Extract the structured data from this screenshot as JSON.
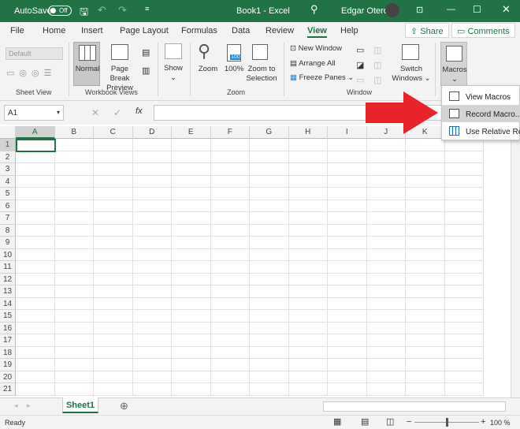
{
  "title_bar": {
    "autosave": "AutoSave",
    "autosave_state": "Off",
    "title": "Book1 - Excel",
    "user": "Edgar Otero",
    "accent": "#217346"
  },
  "tabs": [
    "File",
    "Home",
    "Insert",
    "Page Layout",
    "Formulas",
    "Data",
    "Review",
    "View",
    "Help"
  ],
  "active_tab": "View",
  "share": "Share",
  "comments": "Comments",
  "ribbon": {
    "sheet_view": {
      "dropdown": "Default",
      "label": "Sheet View"
    },
    "workbook_views": {
      "normal": "Normal",
      "page_break_1": "Page Break",
      "page_break_2": "Preview",
      "label": "Workbook Views"
    },
    "show": {
      "label": "Show"
    },
    "zoom": {
      "zoom": "Zoom",
      "hundred": "100%",
      "icon_text": "100",
      "zoom_sel_1": "Zoom to",
      "zoom_sel_2": "Selection",
      "label": "Zoom"
    },
    "window": {
      "new_window": "New Window",
      "arrange_all": "Arrange All",
      "freeze_panes": "Freeze Panes",
      "switch_1": "Switch",
      "switch_2": "Windows",
      "label": "Window"
    },
    "macros": {
      "label": "Macros"
    }
  },
  "macros_menu": [
    "View Macros",
    "Record Macro...",
    "Use Relative References"
  ],
  "name_box": "A1",
  "columns": [
    "A",
    "B",
    "C",
    "D",
    "E",
    "F",
    "G",
    "H",
    "I",
    "J",
    "K",
    "L"
  ],
  "rows": [
    "1",
    "2",
    "3",
    "4",
    "5",
    "6",
    "7",
    "8",
    "9",
    "10",
    "11",
    "12",
    "13",
    "14",
    "15",
    "16",
    "17",
    "18",
    "19",
    "20",
    "21"
  ],
  "sheet_tab": "Sheet1",
  "status": {
    "ready": "Ready",
    "zoom": "100 %",
    "zoom_slider_percent": 50
  },
  "arrow_color": "#e8242a"
}
